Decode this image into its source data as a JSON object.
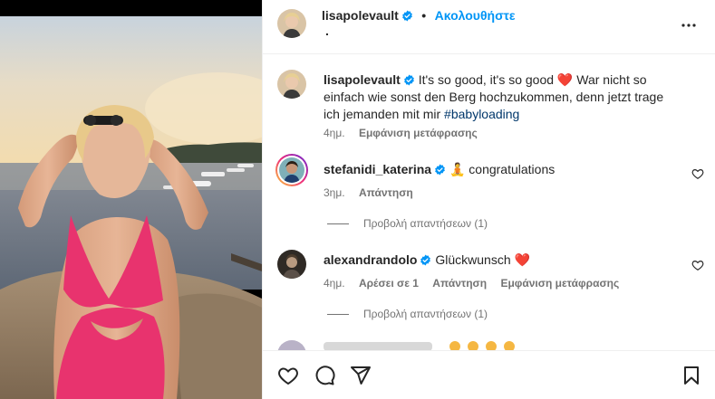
{
  "post": {
    "username": "lisapolevault",
    "follow_label": "Ακολουθήστε",
    "separator": "•",
    "sub_dot": "."
  },
  "caption": {
    "username": "lisapolevault",
    "text_part1": "It's so good, it's so good ",
    "heart": "❤️",
    "text_part2": " War nicht so einfach wie sonst den Berg hochzukommen, denn jetzt trage ich jemanden mit mir ",
    "hashtag": "#babyloading",
    "time": "4ημ.",
    "translate": "Εμφάνιση μετάφρασης"
  },
  "comments": [
    {
      "username": "stefanidi_katerina",
      "emoji": "🧘",
      "text": " congratulations",
      "time": "3ημ.",
      "reply": "Απάντηση",
      "view_replies": "Προβολή απαντήσεων (1)"
    },
    {
      "username": "alexandrandolo",
      "text": "Glückwunsch ",
      "heart": "❤️",
      "time": "4ημ.",
      "likes": "Αρέσει σε 1",
      "reply": "Απάντηση",
      "translate": "Εμφάνιση μετάφρασης",
      "view_replies": "Προβολή απαντήσεων (1)"
    }
  ],
  "icons": {
    "more": "more-horizontal-icon",
    "like": "heart-icon",
    "comment": "comment-icon",
    "share": "share-icon",
    "save": "bookmark-icon",
    "verified": "verified-badge-icon"
  },
  "colors": {
    "link": "#0095f6",
    "hashtag": "#00376b",
    "heart": "#e0245e",
    "muted": "#737373",
    "swimsuit": "#e8336e"
  }
}
